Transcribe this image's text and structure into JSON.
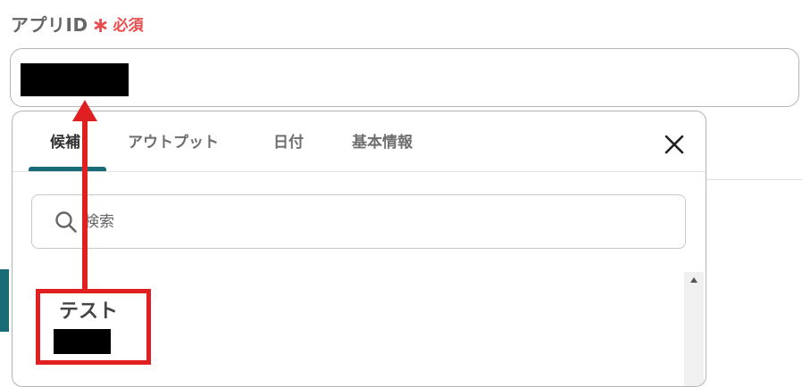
{
  "field": {
    "label": "アプリID",
    "required_mark": "∗",
    "required_text": "必須"
  },
  "dropdown": {
    "tabs": [
      {
        "label": "候補",
        "active": true
      },
      {
        "label": "アウトプット",
        "active": false
      },
      {
        "label": "日付",
        "active": false
      },
      {
        "label": "基本情報",
        "active": false
      }
    ],
    "close_icon": "close-icon",
    "search": {
      "placeholder": "検索",
      "value": "",
      "icon": "search-icon"
    },
    "items": [
      {
        "title": "テスト",
        "value": "[redacted]"
      }
    ]
  },
  "input": {
    "value": "[redacted]"
  },
  "colors": {
    "accent": "#1a6b78",
    "required": "#e84c4c",
    "annotation": "#e02020"
  }
}
